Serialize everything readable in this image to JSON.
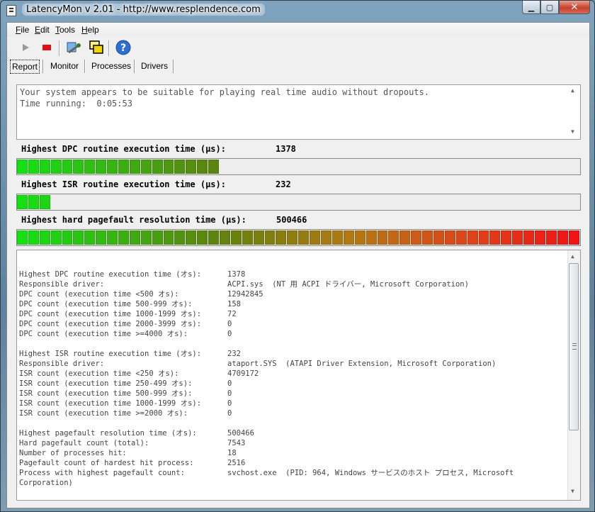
{
  "window": {
    "title": "LatencyMon v 2.01 - http://www.resplendence.com"
  },
  "menu": [
    "File",
    "Edit",
    "Tools",
    "Help"
  ],
  "toolbar": {
    "icons": [
      "play-icon",
      "stop-icon",
      "wrench-icon",
      "windows-icon",
      "help-icon"
    ]
  },
  "tabs": [
    "Report",
    "Monitor",
    "Processes",
    "Drivers"
  ],
  "status": {
    "line1": "Your system appears to be suitable for playing real time audio without dropouts.",
    "line2": "Time running:  0:05:53"
  },
  "metrics": [
    {
      "label": "Highest DPC routine execution time (µs):",
      "value": "1378",
      "fill_fraction": 0.36
    },
    {
      "label": "Highest ISR routine execution time (µs):",
      "value": "232",
      "fill_fraction": 0.06
    },
    {
      "label": "Highest hard pagefault resolution time (µs):",
      "value": "500466",
      "fill_fraction": 1.0
    }
  ],
  "report": {
    "lines": [
      {
        "label": "Highest DPC routine execution time (オs):",
        "value": "1378"
      },
      {
        "label": "Responsible driver:",
        "value": "ACPI.sys  (NT 用 ACPI ドライバー, Microsoft Corporation)"
      },
      {
        "label": "DPC count (execution time <500 オs):",
        "value": "12942845"
      },
      {
        "label": "DPC count (execution time 500-999 オs):",
        "value": "158"
      },
      {
        "label": "DPC count (execution time 1000-1999 オs):",
        "value": "72"
      },
      {
        "label": "DPC count (execution time 2000-3999 オs):",
        "value": "0"
      },
      {
        "label": "DPC count (execution time >=4000 オs):",
        "value": "0"
      },
      {
        "label": "",
        "value": ""
      },
      {
        "label": "Highest ISR routine execution time (オs):",
        "value": "232"
      },
      {
        "label": "Responsible driver:",
        "value": "ataport.SYS  (ATAPI Driver Extension, Microsoft Corporation)"
      },
      {
        "label": "ISR count (execution time <250 オs):",
        "value": "4709172"
      },
      {
        "label": "ISR count (execution time 250-499 オs):",
        "value": "0"
      },
      {
        "label": "ISR count (execution time 500-999 オs):",
        "value": "0"
      },
      {
        "label": "ISR count (execution time 1000-1999 オs):",
        "value": "0"
      },
      {
        "label": "ISR count (execution time >=2000 オs):",
        "value": "0"
      },
      {
        "label": "",
        "value": ""
      },
      {
        "label": "Highest pagefault resolution time (オs):",
        "value": "500466"
      },
      {
        "label": "Hard pagefault count (total):",
        "value": "7543"
      },
      {
        "label": "Number of processes hit:",
        "value": "18"
      },
      {
        "label": "Pagefault count of hardest hit process:",
        "value": "2516"
      },
      {
        "label": "Process with highest pagefault count:",
        "value": "svchost.exe  (PID: 964, Windows サービスのホスト プロセス, Microsoft"
      },
      {
        "label": "Corporation)",
        "value": ""
      }
    ]
  }
}
